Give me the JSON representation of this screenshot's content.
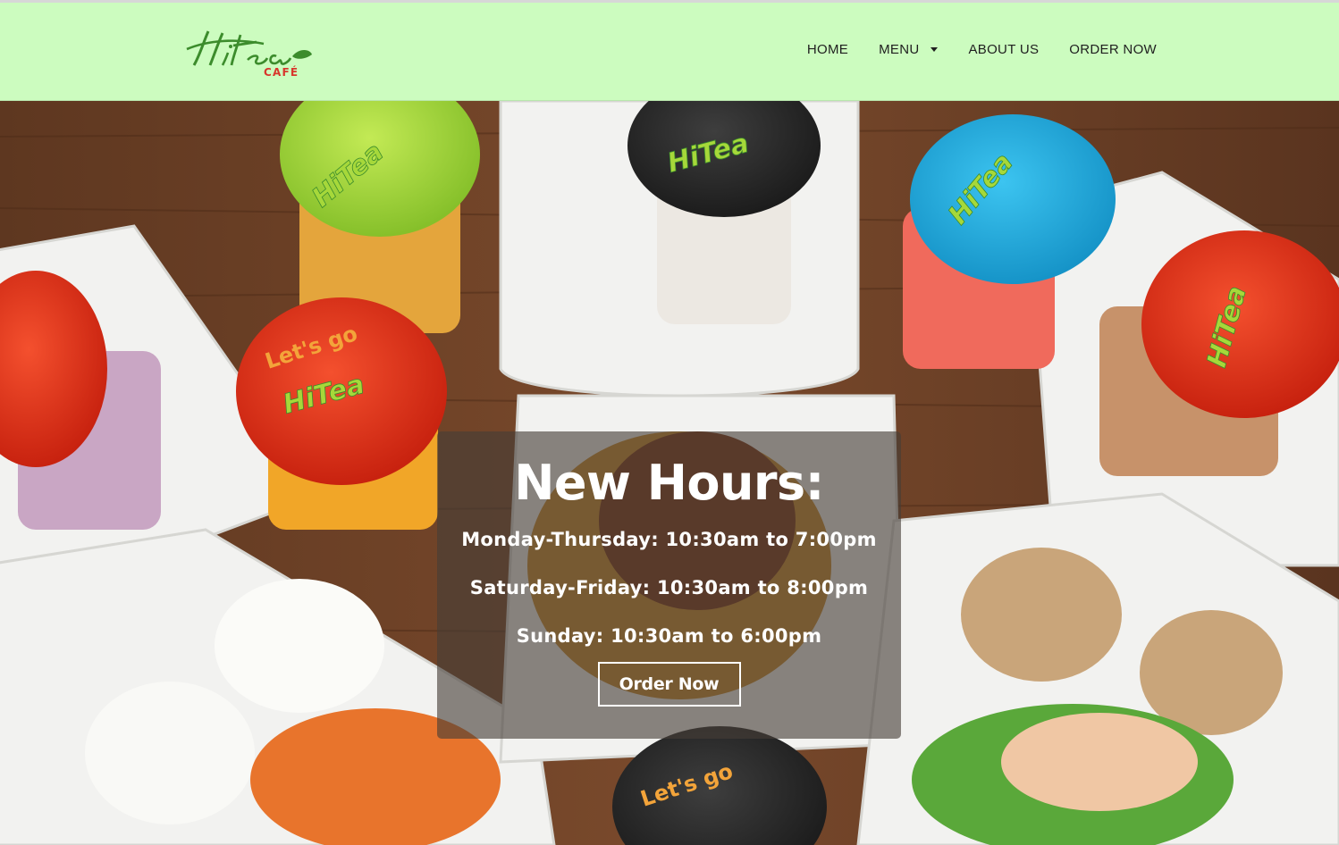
{
  "brand": {
    "logo_script": "HiTea",
    "logo_sub": "CAFÉ",
    "primary_green": "#3c8c2c",
    "accent_red": "#d8362c"
  },
  "nav": {
    "items": [
      {
        "label": "HOME"
      },
      {
        "label": "MENU"
      },
      {
        "label": "ABOUT US"
      },
      {
        "label": "ORDER NOW"
      }
    ]
  },
  "hero": {
    "heading": "New Hours:",
    "hours": [
      "Monday-Thursday: 10:30am to 7:00pm",
      "Saturday-Friday: 10:30am to 8:00pm",
      "Sunday: 10:30am to 6:00pm"
    ],
    "cta_label": "Order Now",
    "cup_lid_text": "Let's go"
  },
  "colors": {
    "header_bg": "#ccfcbf",
    "table_wood": "#6b4026",
    "lid_red": "#e2321e",
    "lid_green": "#a6d83a",
    "lid_blue": "#26aee0",
    "lid_black": "#2b2b2b"
  }
}
